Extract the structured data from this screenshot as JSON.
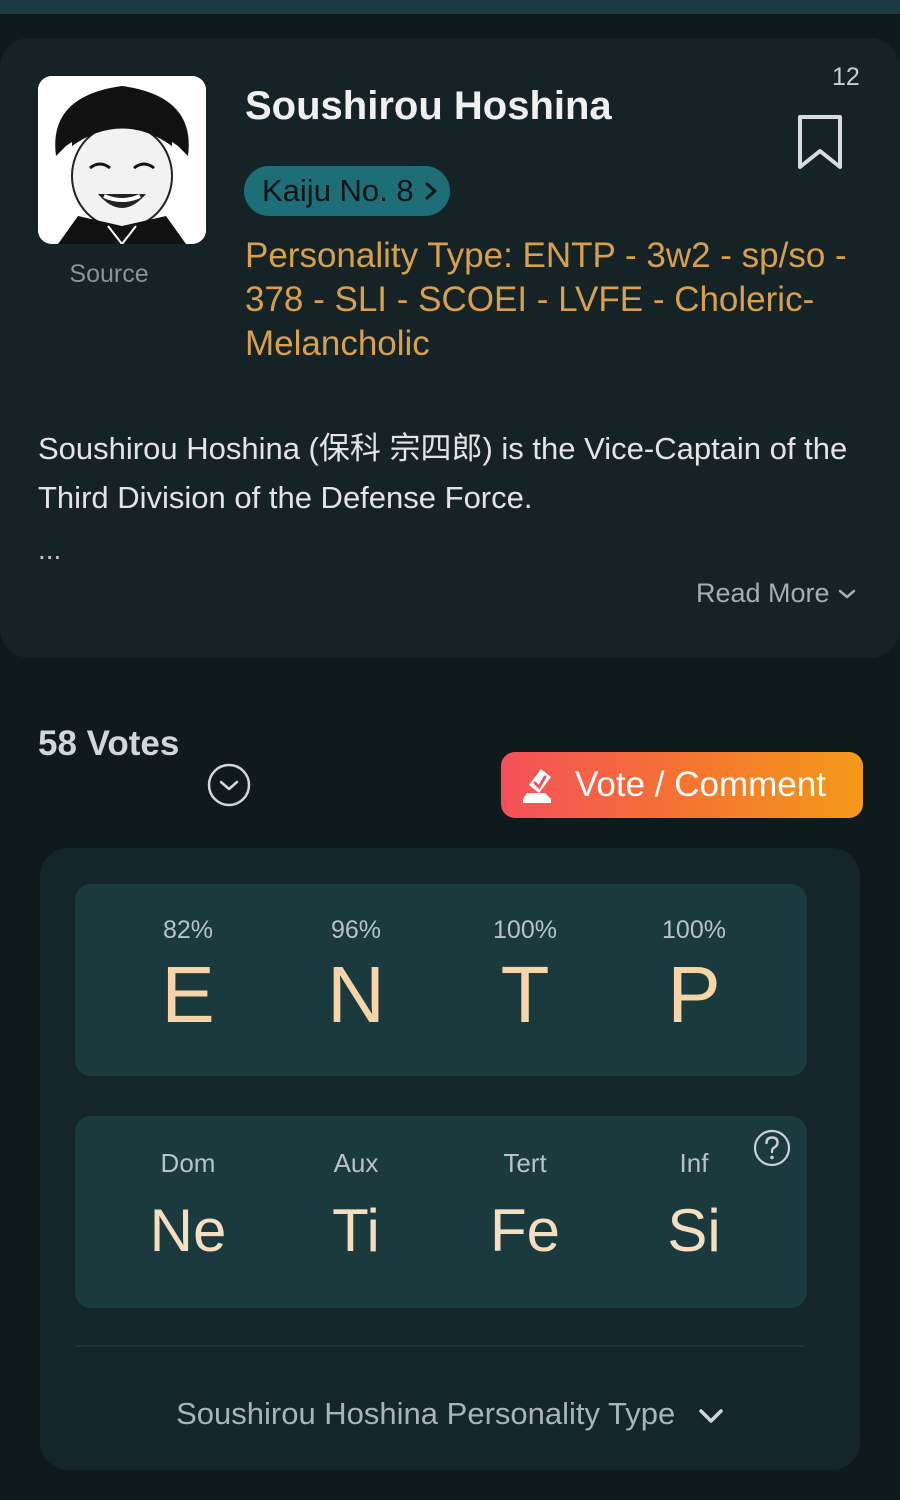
{
  "profile": {
    "name": "Soushirou Hoshina",
    "avatar_source_label": "Source",
    "bookmark_count": "12",
    "series_label": "Kaiju No. 8",
    "personality_type": "Personality Type: ENTP - 3w2 - sp/so - 378 - SLI - SCOEI - LVFE - Choleric-Melancholic",
    "description": "Soushirou Hoshina (保科 宗四郎) is the Vice-Captain of the Third Division of the Defense Force.",
    "ellipsis": "...",
    "read_more_label": "Read More"
  },
  "votes": {
    "count_label": "58 Votes",
    "vote_button_label": "Vote / Comment"
  },
  "type_breakdown": {
    "letters": [
      {
        "percent": "82%",
        "letter": "E"
      },
      {
        "percent": "96%",
        "letter": "N"
      },
      {
        "percent": "100%",
        "letter": "T"
      },
      {
        "percent": "100%",
        "letter": "P"
      }
    ],
    "functions": [
      {
        "label": "Dom",
        "fn": "Ne"
      },
      {
        "label": "Aux",
        "fn": "Ti"
      },
      {
        "label": "Tert",
        "fn": "Fe"
      },
      {
        "label": "Inf",
        "fn": "Si"
      }
    ],
    "footer_label": "Soushirou Hoshina Personality Type"
  },
  "colors": {
    "accent_gold": "#d6a04e",
    "series_pill": "#1e6e78",
    "vote_gradient_start": "#f4505a",
    "vote_gradient_end": "#f49a19"
  },
  "icons": [
    "bookmark-icon",
    "chevron-right-icon",
    "chevron-down-icon",
    "vote-icon",
    "help-icon"
  ]
}
